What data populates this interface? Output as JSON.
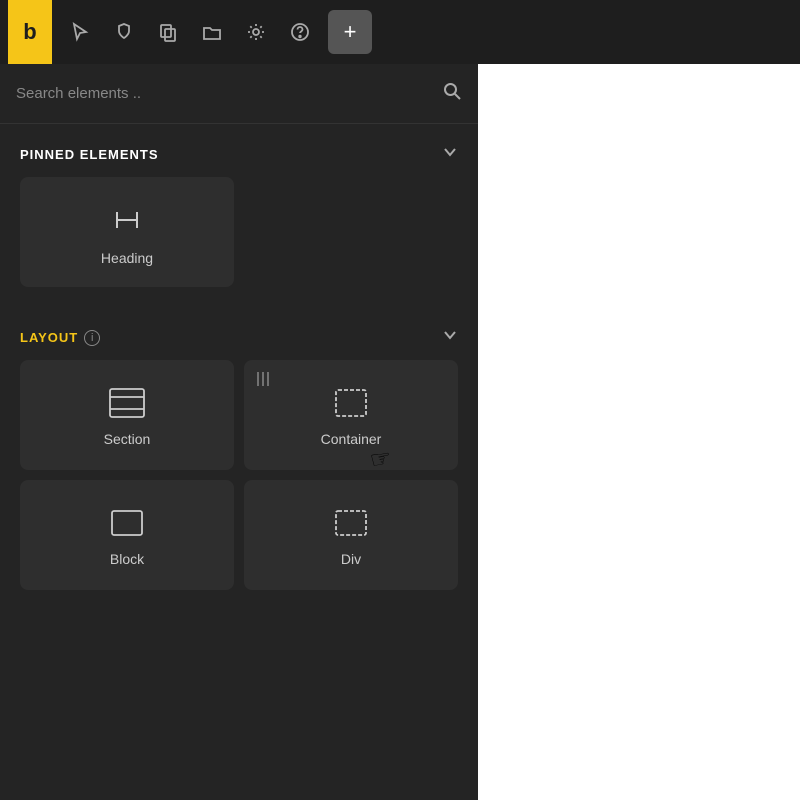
{
  "toolbar": {
    "logo": "b",
    "buttons": [
      {
        "name": "cursor-tool",
        "icon": "cursor"
      },
      {
        "name": "shield-tool",
        "icon": "shield"
      },
      {
        "name": "copy-tool",
        "icon": "copy"
      },
      {
        "name": "folder-tool",
        "icon": "folder"
      },
      {
        "name": "settings-tool",
        "icon": "settings"
      },
      {
        "name": "help-tool",
        "icon": "help"
      }
    ],
    "add_button": "+"
  },
  "search": {
    "placeholder": "Search elements ..",
    "value": ""
  },
  "pinned_section": {
    "title": "PINNED ELEMENTS",
    "elements": [
      {
        "id": "heading",
        "label": "Heading",
        "icon": "heading"
      }
    ]
  },
  "layout_section": {
    "title": "LAYOUT",
    "info": "i",
    "elements": [
      {
        "id": "section",
        "label": "Section",
        "icon": "section"
      },
      {
        "id": "container",
        "label": "Container",
        "icon": "container"
      },
      {
        "id": "block",
        "label": "Block",
        "icon": "block"
      },
      {
        "id": "div",
        "label": "Div",
        "icon": "div"
      }
    ]
  }
}
